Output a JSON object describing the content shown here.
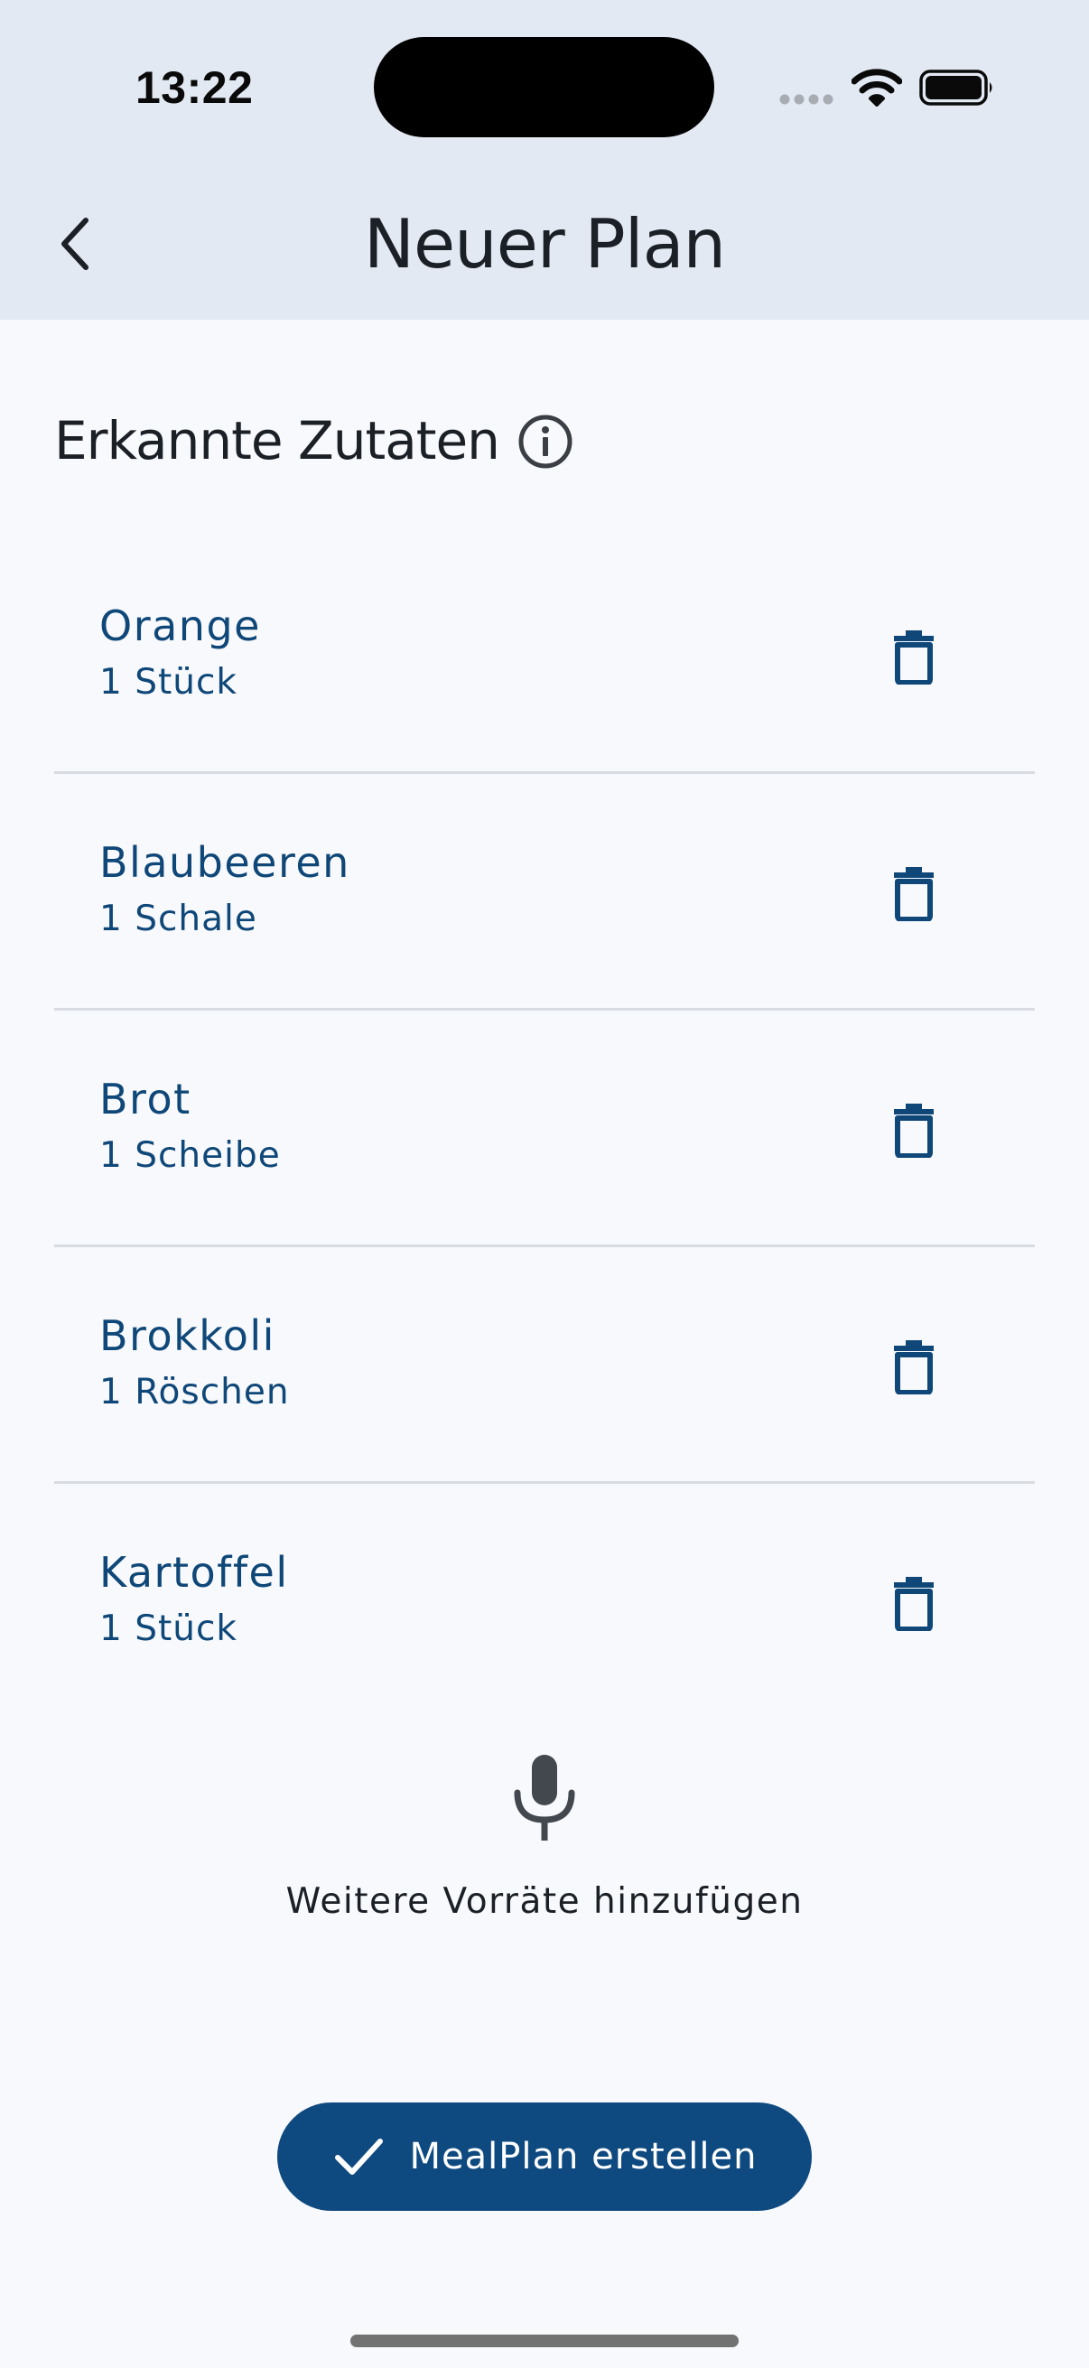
{
  "status_bar": {
    "time": "13:22"
  },
  "nav": {
    "title": "Neuer Plan",
    "back_icon": "chevron-left-icon"
  },
  "section": {
    "title": "Erkannte Zutaten",
    "info_icon": "info-icon"
  },
  "ingredients": [
    {
      "name": "Orange",
      "quantity": "1 Stück"
    },
    {
      "name": "Blaubeeren",
      "quantity": "1 Schale"
    },
    {
      "name": "Brot",
      "quantity": "1 Scheibe"
    },
    {
      "name": "Brokkoli",
      "quantity": "1 Röschen"
    },
    {
      "name": "Kartoffel",
      "quantity": "1 Stück"
    }
  ],
  "voice_input": {
    "icon": "microphone-icon",
    "label": "Weitere Vorräte hinzufügen"
  },
  "primary_action": {
    "icon": "checkmark-icon",
    "label": "MealPlan erstellen"
  },
  "colors": {
    "header_background": "#e3e9f2",
    "page_background": "#f7f9fc",
    "accent": "#0e4a80",
    "ingredient_text": "#0f4778",
    "divider": "#d8dce2"
  }
}
